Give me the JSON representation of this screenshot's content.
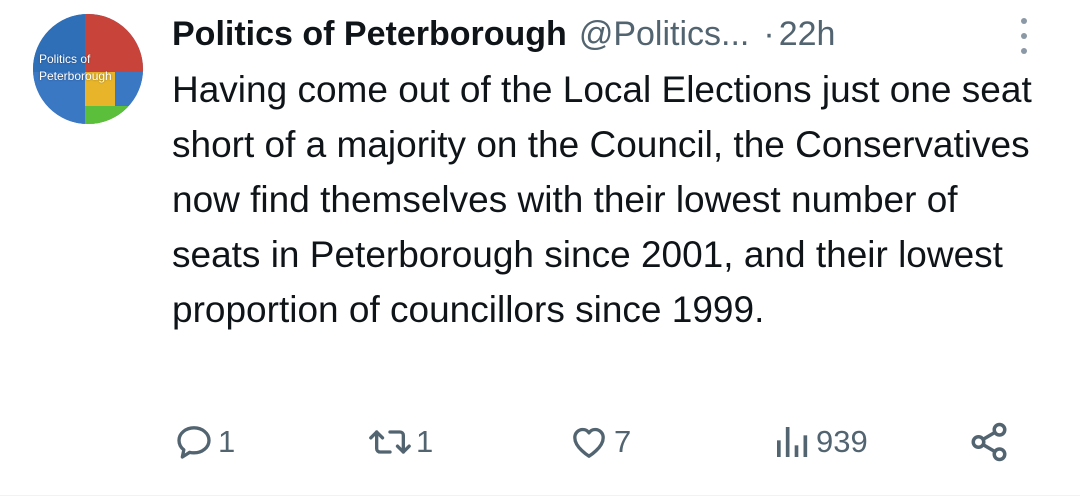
{
  "tweet": {
    "avatar_text": "Politics of\nPeterborough",
    "display_name": "Politics of Peterborough",
    "handle": "@Politics...",
    "separator": "·",
    "time": "22h",
    "text": "Having come out of the Local Elections just one seat short of a majority on the Council, the Conservatives now find themselves with their lowest number of seats in Peterborough since 2001, and their lowest proportion of councillors since 1999."
  },
  "actions": {
    "reply_count": "1",
    "retweet_count": "1",
    "like_count": "7",
    "views_count": "939"
  },
  "icons": {
    "reply": "reply-icon",
    "retweet": "retweet-icon",
    "like": "heart-icon",
    "views": "views-icon",
    "share": "share-icon",
    "more": "more-vertical-icon"
  },
  "colors": {
    "text": "#0f1419",
    "secondary": "#536471",
    "divider": "#eff3f4"
  }
}
